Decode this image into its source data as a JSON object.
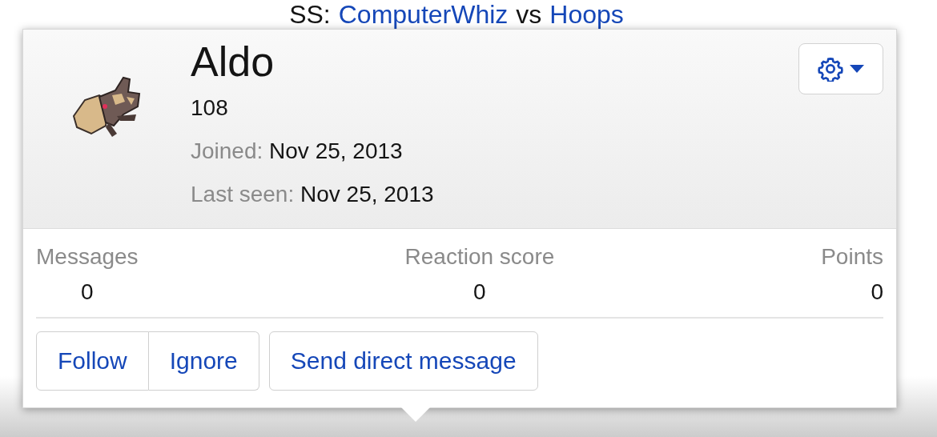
{
  "background_heading": {
    "prefix": "SS:",
    "player_1": "ComputerWhiz",
    "separator": "vs",
    "player_2": "Hoops"
  },
  "profile_card": {
    "name": "Aldo",
    "subtitle": "108",
    "facts": [
      {
        "label": "Joined:",
        "value": "Nov 25, 2013"
      },
      {
        "label": "Last seen:",
        "value": "Nov 25, 2013"
      }
    ],
    "stats": [
      {
        "label": "Messages",
        "value": "0"
      },
      {
        "label": "Reaction score",
        "value": "0"
      },
      {
        "label": "Points",
        "value": "0"
      }
    ],
    "actions": [
      {
        "label": "Follow",
        "kind": "group"
      },
      {
        "label": "Ignore",
        "kind": "group"
      },
      {
        "label": "Send direct message",
        "kind": "single"
      }
    ]
  }
}
